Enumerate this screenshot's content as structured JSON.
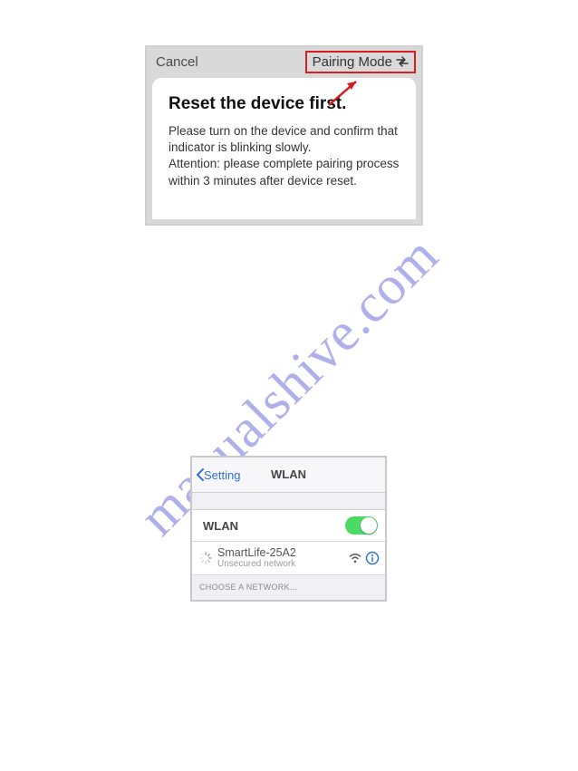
{
  "watermark": "manualshive.com",
  "shot1": {
    "cancel_label": "Cancel",
    "pairing_label": "Pairing Mode",
    "title": "Reset the device first.",
    "body_line1": "Please turn on the device and confirm that",
    "body_line2": "indicator is blinking slowly.",
    "body_line3": "Attention: please complete pairing process",
    "body_line4": "within 3 minutes after device reset."
  },
  "shot2": {
    "back_label": "Setting",
    "nav_title": "WLAN",
    "row_label": "WLAN",
    "network_name": "SmartLife-25A2",
    "network_sub": "Unsecured network",
    "choose_label": "CHOOSE A NETWORK..."
  }
}
